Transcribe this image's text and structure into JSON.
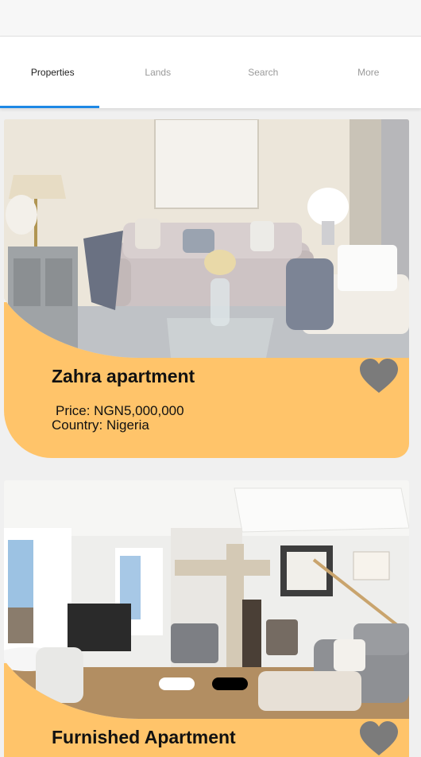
{
  "tabs": [
    {
      "label": "Properties",
      "active": true
    },
    {
      "label": "Lands",
      "active": false
    },
    {
      "label": "Search",
      "active": false
    },
    {
      "label": "More",
      "active": false
    }
  ],
  "listings": [
    {
      "title": "Zahra apartment",
      "price": "Price: NGN5,000,000",
      "country": "Country: Nigeria",
      "favorite_icon": "heart-icon"
    },
    {
      "title": "Furnished Apartment",
      "favorite_icon": "heart-icon"
    }
  ],
  "carousel": {
    "active_index": 0,
    "count": 2
  },
  "colors": {
    "accent": "#1e88e5",
    "card_band": "#ffc46a",
    "heart": "#7b7b7b"
  }
}
